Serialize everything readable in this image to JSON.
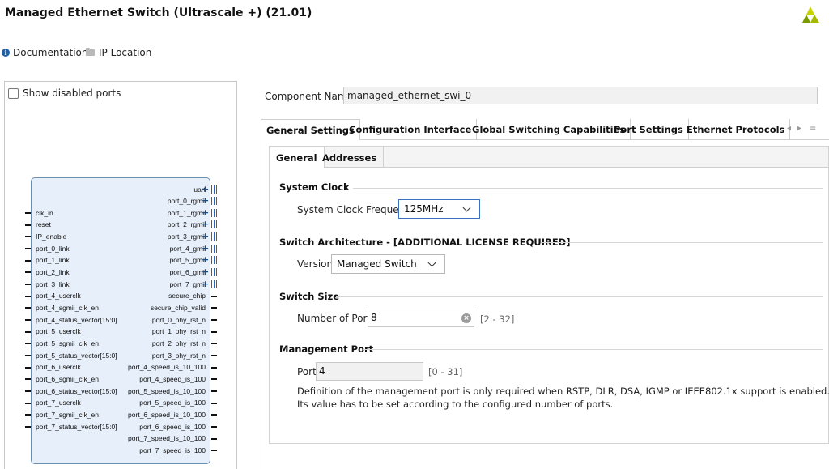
{
  "header": {
    "title": "Managed Ethernet Switch (Ultrascale +) (21.01)",
    "links": {
      "documentation": "Documentation",
      "ip_location": "IP Location"
    }
  },
  "left_panel": {
    "show_disabled_label": "Show disabled ports",
    "left_ports": [
      "clk_in",
      "reset",
      "IP_enable",
      "port_0_link",
      "port_1_link",
      "port_2_link",
      "port_3_link",
      "port_4_userclk",
      "port_4_sgmii_clk_en",
      "port_4_status_vector[15:0]",
      "port_5_userclk",
      "port_5_sgmii_clk_en",
      "port_5_status_vector[15:0]",
      "port_6_userclk",
      "port_6_sgmii_clk_en",
      "port_6_status_vector[15:0]",
      "port_7_userclk",
      "port_7_sgmii_clk_en",
      "port_7_status_vector[15:0]"
    ],
    "right_bus_ports": [
      "uart",
      "port_0_rgmii",
      "port_1_rgmii",
      "port_2_rgmii",
      "port_3_rgmii",
      "port_4_gmii",
      "port_5_gmii",
      "port_6_gmii",
      "port_7_gmii"
    ],
    "right_ports": [
      "secure_chip",
      "secure_chip_valid",
      "port_0_phy_rst_n",
      "port_1_phy_rst_n",
      "port_2_phy_rst_n",
      "port_3_phy_rst_n",
      "port_4_speed_is_10_100",
      "port_4_speed_is_100",
      "port_5_speed_is_10_100",
      "port_5_speed_is_100",
      "port_6_speed_is_10_100",
      "port_6_speed_is_100",
      "port_7_speed_is_10_100",
      "port_7_speed_is_100"
    ]
  },
  "component": {
    "label": "Component Name",
    "value": "managed_ethernet_swi_0"
  },
  "tabs": [
    "General Settings",
    "Configuration Interface",
    "Global Switching Capabilities",
    "Port Settings",
    "Ethernet Protocols"
  ],
  "subtabs": [
    "General",
    "Addresses"
  ],
  "system_clock": {
    "title": "System Clock",
    "label": "System Clock Frequency",
    "value": "125MHz"
  },
  "switch_arch": {
    "title": "Switch Architecture - [ADDITIONAL LICENSE REQUIRED]",
    "label": "Version",
    "value": "Managed Switch"
  },
  "switch_size": {
    "title": "Switch Size",
    "label": "Number of Ports",
    "value": "8",
    "range": "[2 - 32]"
  },
  "mgmt_port": {
    "title": "Management Port",
    "label": "Port",
    "value": "4",
    "range": "[0 - 31]",
    "desc1": "Definition of the management port is only required when RSTP, DLR, DSA, IGMP or IEEE802.1x support is enabled.",
    "desc2": "Its value has to be set according to the configured number of ports."
  },
  "colors": {
    "accent": "#3a70c7",
    "block_fill": "#e6effa",
    "bus": "#2c62b0"
  }
}
